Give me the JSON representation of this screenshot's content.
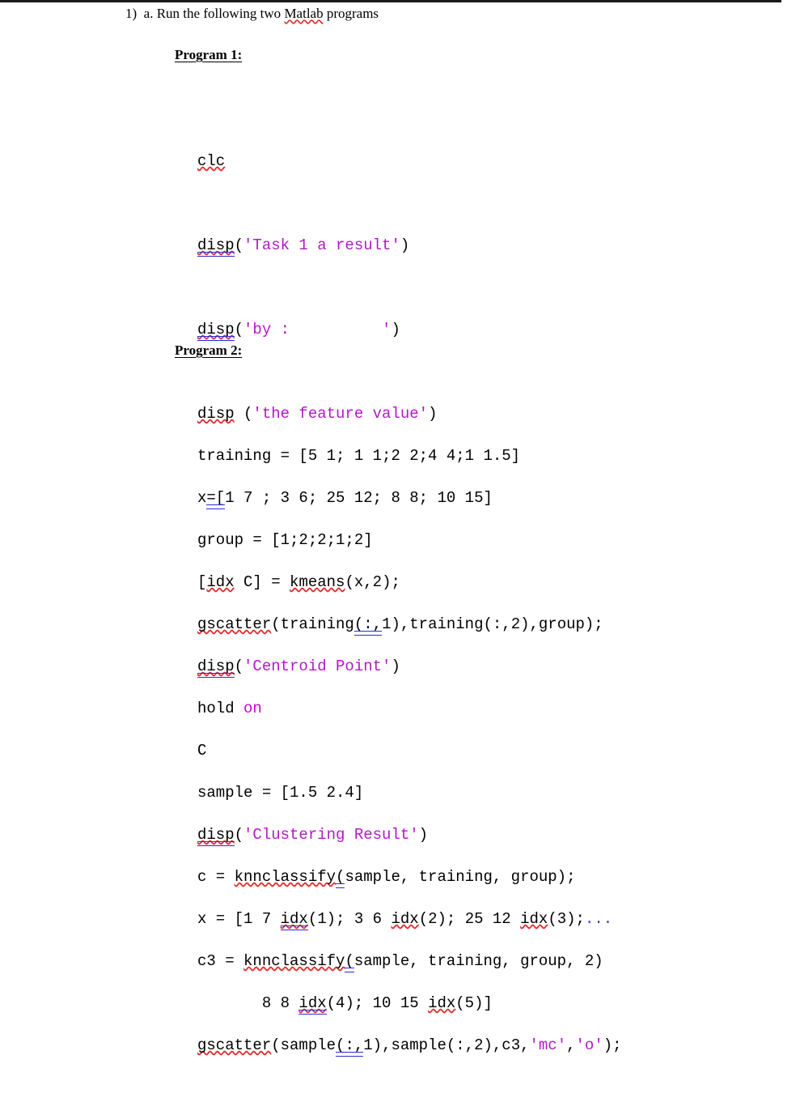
{
  "document": {
    "question": {
      "number": "1)",
      "sub_letter": "a.",
      "text_before": "Run the following two ",
      "misspelled_word": "Matlab",
      "text_after": " programs"
    },
    "program1": {
      "heading": "Program 1:",
      "lines": [
        "clc",
        "disp('Task 1 a result')",
        "disp('by :          ')",
        "disp ('the feature value')",
        "x=[1 7 ; 3 6; 25 12; 8 8; 10 15]",
        "[idx C] = kmeans(x,2);",
        "disp('Centroid Point')",
        "C",
        "disp('Clustering Result')",
        "x = [1 7 idx(1); 3 6 idx(2); 25 12 idx(3);...",
        "      8 8 idx(4); 10 15 idx(5)]"
      ],
      "tokens": {
        "line1_cmd": "clc",
        "line2_fn": "disp",
        "line2_str": "'Task 1 a result'",
        "line3_fn": "disp",
        "line3_str": "'by :          '",
        "line4_fn": "disp",
        "line4_str": "'the feature value'",
        "line5_var": "x",
        "line5_assign": "=[",
        "line5_rest": "1 7 ; 3 6; 25 12; 8 8; 10 15]",
        "line6_open": "[",
        "line6_idx": "idx",
        "line6_mid": " C] = ",
        "line6_fn": "kmeans",
        "line6_args": "(x,2);",
        "line7_fn": "disp",
        "line7_str": "'Centroid Point'",
        "line8_var": "C",
        "line9_fn": "disp",
        "line9_str": "'Clustering Result'",
        "line10_pre": "x = [1 7 ",
        "line10_idx1": "idx",
        "line10_a1": "(1); 3 6 ",
        "line10_idx2": "idx",
        "line10_a2": "(2); 25 12 ",
        "line10_idx3": "idx",
        "line10_a3": "(3);",
        "line10_cont": "...",
        "line11_pre": "       8 8 ",
        "line11_idx4": "idx",
        "line11_a4": "(4); 10 15 ",
        "line11_idx5": "idx",
        "line11_a5": "(5)]"
      }
    },
    "program2": {
      "heading": "Program 2:",
      "lines": [
        "training = [5 1; 1 1;2 2;4 4;1 1.5]",
        "group = [1;2;2;1;2]",
        "gscatter(training(:,1),training(:,2),group);",
        "hold on",
        "sample = [1.5 2.4]",
        "c = knnclassify(sample, training, group);",
        "c3 = knnclassify(sample, training, group, 2)",
        "gscatter(sample(:,1),sample(:,2),c3,'mc','o');"
      ],
      "tokens": {
        "line1": "training = [5 1; 1 1;2 2;4 4;1 1.5]",
        "line2": "group = [1;2;2;1;2]",
        "line3_fn": "gscatter",
        "line3_a": "(training",
        "line3_colon": "(:,",
        "line3_b": "1),training(:,2),group);",
        "line4_cmd": "hold ",
        "line4_kw": "on",
        "line5": "sample = [1.5 2.4]",
        "line6_pre": "c = ",
        "line6_fn": "knnclassify",
        "line6_paren": "(",
        "line6_rest": "sample, training, group);",
        "line7_pre": "c3 = ",
        "line7_fn": "knnclassify",
        "line7_paren": "(",
        "line7_rest": "sample, training, group, 2)",
        "line8_fn": "gscatter",
        "line8_a": "(sample",
        "line8_colon": "(:,",
        "line8_b": "1),sample(:,2),c3,",
        "line8_str1": "'mc'",
        "line8_comma": ",",
        "line8_str2": "'o'",
        "line8_end": ");"
      }
    },
    "colors": {
      "string_magenta": "#b318c8",
      "keyword_magenta": "#d000d0",
      "continuation_blue": "#4a3ccf",
      "spell_underline_red": "#e03030",
      "grammar_underline_blue": "#2b2bd6",
      "text_black": "#000000",
      "page_background": "#ffffff"
    }
  }
}
